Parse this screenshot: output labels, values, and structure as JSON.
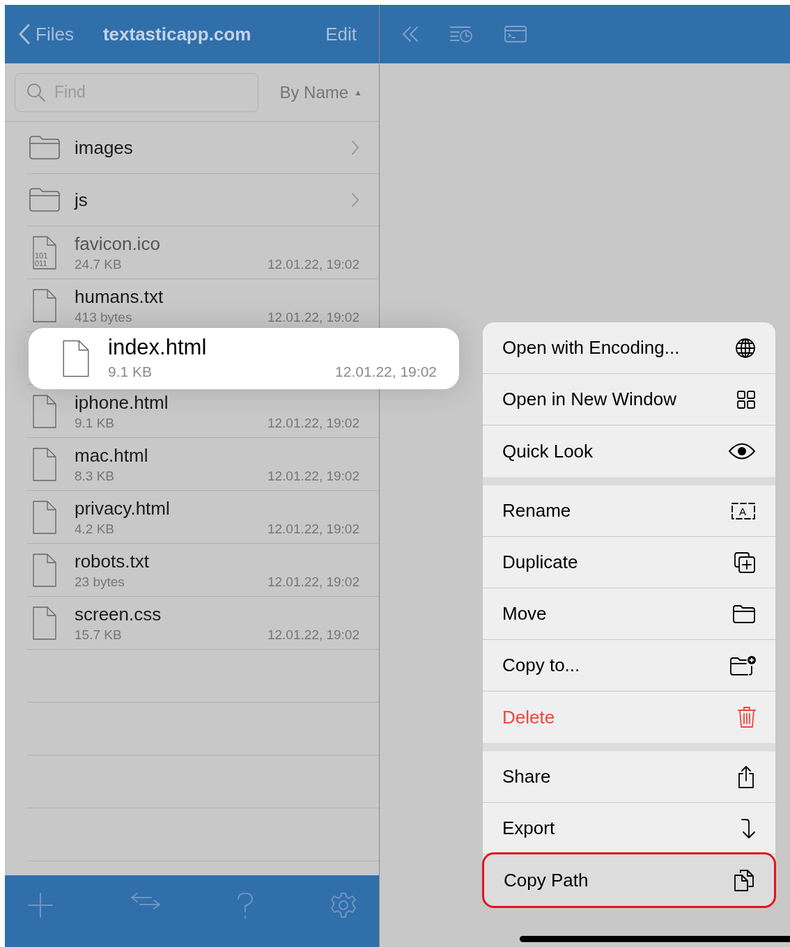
{
  "header": {
    "back": "Files",
    "title": "textasticapp.com",
    "edit": "Edit"
  },
  "search": {
    "placeholder": "Find"
  },
  "sort": {
    "label": "By Name",
    "arrow": "▲"
  },
  "files": [
    {
      "kind": "folder",
      "name": "images",
      "lifted": false
    },
    {
      "kind": "folder",
      "name": "js",
      "lifted": false
    },
    {
      "kind": "binary",
      "icon_text": [
        "101",
        "011"
      ],
      "name": "favicon.ico",
      "size": "24.7 KB",
      "date": "12.01.22, 19:02",
      "lifted": false
    },
    {
      "kind": "file",
      "name": "humans.txt",
      "size": "413 bytes",
      "date": "12.01.22, 19:02",
      "lifted": false
    },
    {
      "kind": "file",
      "name": "index.html",
      "size": "9.1 KB",
      "date": "12.01.22, 19:02",
      "lifted": true
    },
    {
      "kind": "file",
      "name": "iphone.html",
      "size": "9.1 KB",
      "date": "12.01.22, 19:02",
      "lifted": false
    },
    {
      "kind": "file",
      "name": "mac.html",
      "size": "8.3 KB",
      "date": "12.01.22, 19:02",
      "lifted": false
    },
    {
      "kind": "file",
      "name": "privacy.html",
      "size": "4.2 KB",
      "date": "12.01.22, 19:02",
      "lifted": false
    },
    {
      "kind": "file",
      "name": "robots.txt",
      "size": "23 bytes",
      "date": "12.01.22, 19:02",
      "lifted": false
    },
    {
      "kind": "file",
      "name": "screen.css",
      "size": "15.7 KB",
      "date": "12.01.22, 19:02",
      "lifted": false
    }
  ],
  "menu": [
    [
      {
        "label": "Open with Encoding...",
        "destructive": false,
        "highlighted": false
      },
      {
        "label": "Open in New Window",
        "destructive": false,
        "highlighted": false
      },
      {
        "label": "Quick Look",
        "destructive": false,
        "highlighted": false
      }
    ],
    [
      {
        "label": "Rename",
        "icon_text": "A",
        "destructive": false,
        "highlighted": false
      },
      {
        "label": "Duplicate",
        "destructive": false,
        "highlighted": false
      },
      {
        "label": "Move",
        "destructive": false,
        "highlighted": false
      },
      {
        "label": "Copy to...",
        "destructive": false,
        "highlighted": false
      },
      {
        "label": "Delete",
        "destructive": true,
        "highlighted": false
      }
    ],
    [
      {
        "label": "Share",
        "destructive": false,
        "highlighted": false
      },
      {
        "label": "Export",
        "destructive": false,
        "highlighted": false
      },
      {
        "label": "Copy Path",
        "destructive": false,
        "highlighted": true
      }
    ]
  ]
}
